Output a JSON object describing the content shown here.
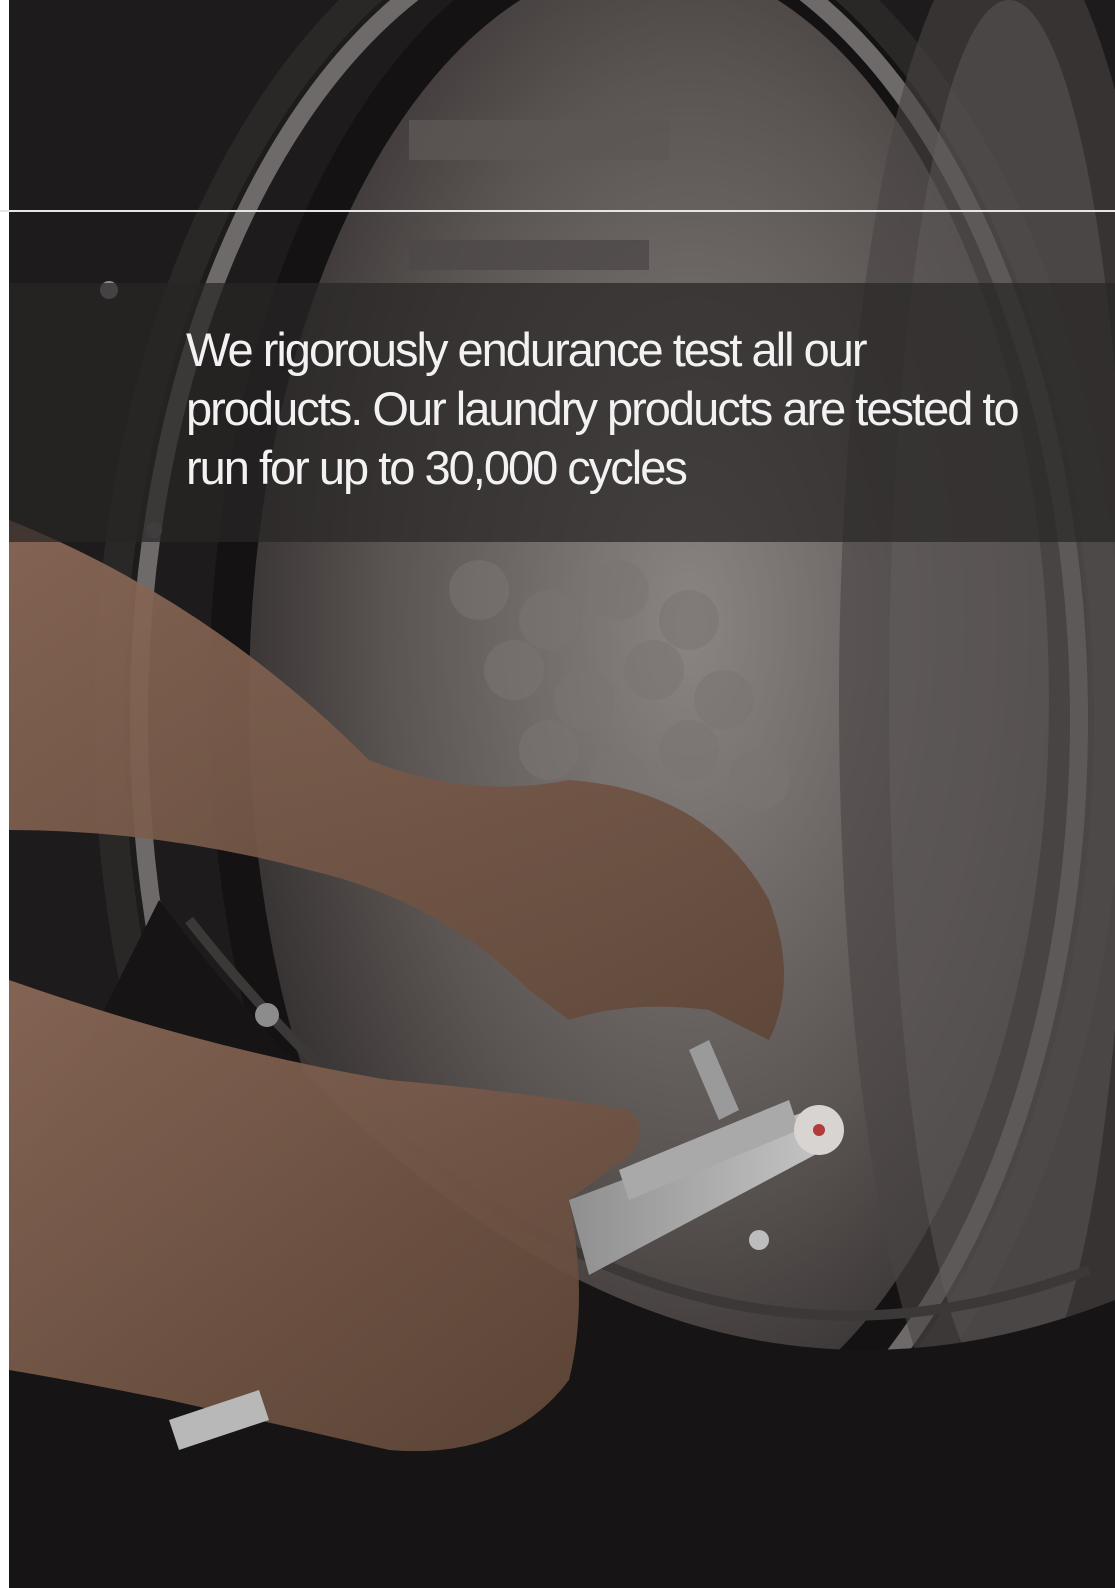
{
  "caption": {
    "text": "We rigorously endurance test all our products. Our laundry products are tested to run for up to 30,000 cycles"
  },
  "colors": {
    "caption_text": "#f2f2f2",
    "band": "#282626",
    "rule": "#e6e6e6"
  }
}
